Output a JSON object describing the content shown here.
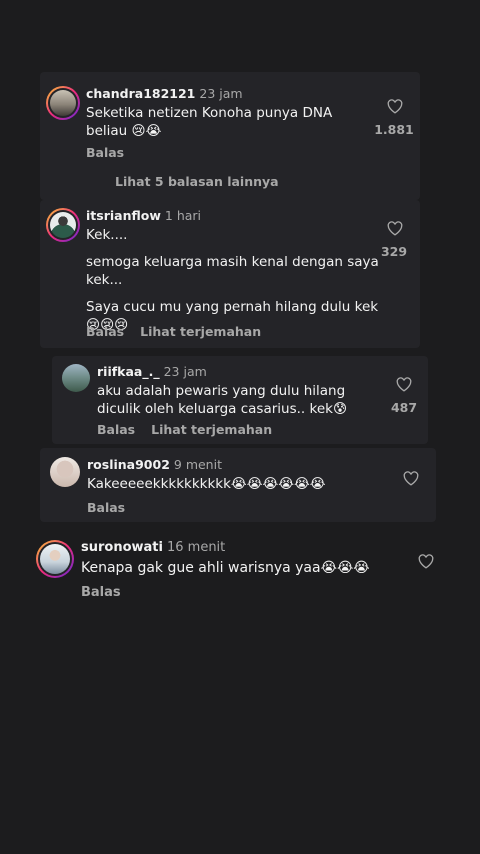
{
  "comments": [
    {
      "username": "chandra182121",
      "time": "23 jam",
      "lines": [
        "Seketika netizen Konoha punya DNA",
        "beliau 😢😭"
      ],
      "likes": "1.881",
      "reply_label": "Balas",
      "more_replies": "Lihat 5 balasan lainnya"
    },
    {
      "username": "itsrianflow",
      "time": "1 hari",
      "lines": [
        "Kek....",
        "semoga keluarga masih kenal dengan saya",
        "kek...",
        "Saya cucu mu yang pernah hilang dulu kek",
        "😢😢😢"
      ],
      "likes": "329",
      "reply_label": "Balas",
      "translate_label": "Lihat terjemahan"
    },
    {
      "username": "riifkaa_._",
      "time": "23 jam",
      "lines": [
        "aku adalah pewaris yang dulu hilang",
        "diculik oleh keluarga casarius.. kek😰"
      ],
      "likes": "487",
      "reply_label": "Balas",
      "translate_label": "Lihat terjemahan"
    },
    {
      "username": "roslina9002",
      "time": "9 menit",
      "lines": [
        "Kakeeeeekkkkkkkkkk😭😭😭😭😭😭"
      ],
      "reply_label": "Balas"
    },
    {
      "username": "suronowati",
      "time": "16 menit",
      "lines": [
        "Kenapa gak gue ahli warisnya yaa😭😭😭"
      ],
      "reply_label": "Balas"
    }
  ],
  "colors": {
    "background": "#1c1c1e",
    "card": "#242428",
    "primary_text": "#f2f2f2",
    "secondary_text": "#a8a8a8"
  },
  "icons": {
    "like": "heart-outline-icon"
  }
}
